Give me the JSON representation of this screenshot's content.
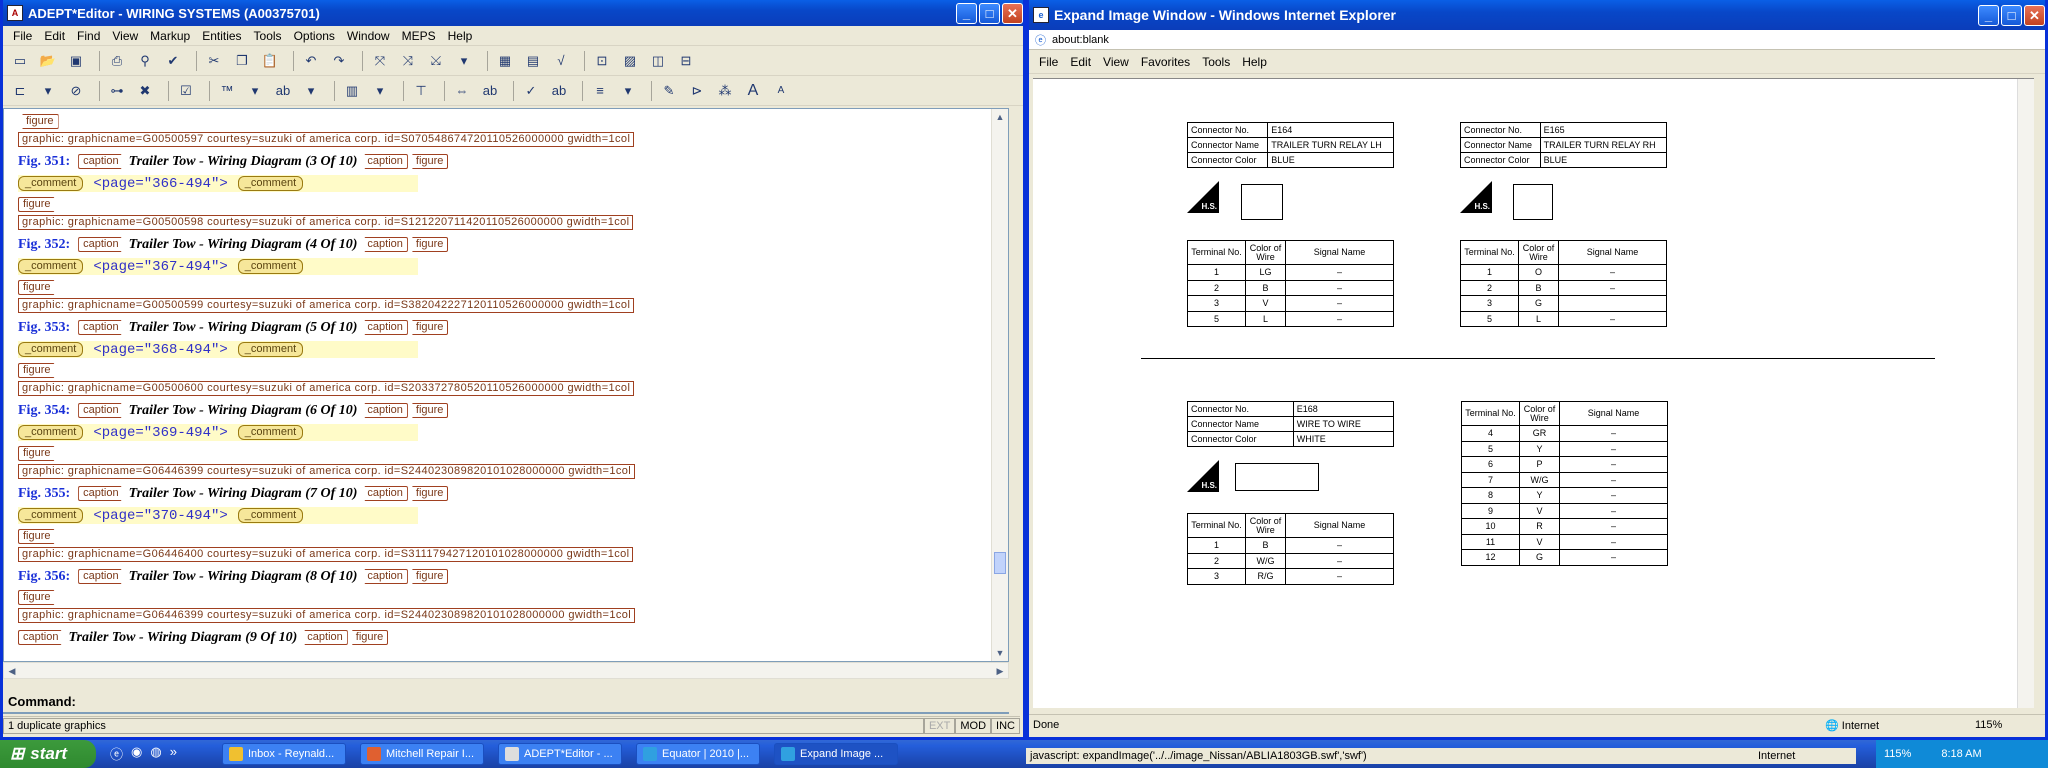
{
  "editor": {
    "title": "ADEPT*Editor - WIRING SYSTEMS (A00375701)",
    "menu": [
      "File",
      "Edit",
      "Find",
      "View",
      "Markup",
      "Entities",
      "Tools",
      "Options",
      "Window",
      "MEPS",
      "Help"
    ],
    "toolbar1_icons": [
      "open-folder-icon",
      "save-icon",
      "print-icon",
      "binoculars-icon",
      "spellcheck-icon",
      "cut-icon",
      "copy-icon",
      "paste-icon",
      "undo-icon",
      "redo-icon",
      "insert-tag-icon",
      "change-tag-icon",
      "split-tag-icon",
      "dropdown-icon",
      "table-icon",
      "matrix-icon",
      "equation-icon",
      "zoom-icon",
      "graphic-icon",
      "columns-icon",
      "rows-icon"
    ],
    "toolbar2_icons": [
      "element-icon",
      "attribute-icon",
      "link-icon",
      "delete-link-icon",
      "check-icon",
      "trademark-icon",
      "spelling-icon",
      "list-icon",
      "tree-icon",
      "expand-icon",
      "abc-icon",
      "align-icon",
      "format-icon",
      "bold-icon",
      "edit-tool-icon",
      "text-larger-icon",
      "text-smaller-icon"
    ],
    "doc": {
      "graphics": [
        "graphic: graphicname=G00500597  courtesy=suzuki  of  america  corp.  id=S070548674720110526000000  gwidth=1col",
        "graphic: graphicname=G00500598  courtesy=suzuki  of  america  corp.  id=S121220711420110526000000  gwidth=1col",
        "graphic: graphicname=G00500599  courtesy=suzuki  of  america  corp.  id=S382042227120110526000000  gwidth=1col",
        "graphic: graphicname=G00500600  courtesy=suzuki  of  america  corp.  id=S203372780520110526000000  gwidth=1col",
        "graphic: graphicname=G06446399  courtesy=suzuki  of  america  corp.  id=S244023089820101028000000  gwidth=1col",
        "graphic: graphicname=G06446400  courtesy=suzuki  of  america  corp.  id=S311179427120101028000000  gwidth=1col",
        "graphic: graphicname=G06446399  courtesy=suzuki  of  america  corp.  id=S244023089820101028000000  gwidth=1col"
      ],
      "figures": [
        {
          "no": "Fig. 351:",
          "caption": "Trailer Tow - Wiring Diagram (3 Of 10)",
          "page": "<page=\"366-494\">"
        },
        {
          "no": "Fig. 352:",
          "caption": "Trailer Tow - Wiring Diagram (4 Of 10)",
          "page": "<page=\"367-494\">"
        },
        {
          "no": "Fig. 353:",
          "caption": "Trailer Tow - Wiring Diagram (5 Of 10)",
          "page": "<page=\"368-494\">"
        },
        {
          "no": "Fig. 354:",
          "caption": "Trailer Tow - Wiring Diagram (6 Of 10)",
          "page": "<page=\"369-494\">"
        },
        {
          "no": "Fig. 355:",
          "caption": "Trailer Tow - Wiring Diagram (7 Of 10)",
          "page": "<page=\"370-494\">"
        },
        {
          "no": "Fig. 356:",
          "caption": "Trailer Tow - Wiring Diagram (8 Of 10)"
        }
      ],
      "last_caption": "Trailer Tow - Wiring Diagram (9 Of 10)",
      "tag_figure": "figure",
      "tag_caption": "caption",
      "tag_comment": "_comment"
    },
    "command_label": "Command:",
    "status_message": "1 duplicate graphics",
    "status_cells": [
      "EXT",
      "MOD",
      "INC"
    ]
  },
  "ie": {
    "title": "Expand Image Window - Windows Internet Explorer",
    "address": "about:blank",
    "menu": [
      "File",
      "Edit",
      "View",
      "Favorites",
      "Tools",
      "Help"
    ],
    "status_text": "Done",
    "zone": "Internet",
    "zoom": "115%",
    "connectors": [
      {
        "no": "E164",
        "name": "TRAILER TURN RELAY LH",
        "color": "BLUE",
        "rows": [
          [
            "1",
            "LG",
            "–"
          ],
          [
            "2",
            "B",
            "–"
          ],
          [
            "3",
            "V",
            "–"
          ],
          [
            "5",
            "L",
            "–"
          ]
        ]
      },
      {
        "no": "E165",
        "name": "TRAILER TURN RELAY RH",
        "color": "BLUE",
        "rows": [
          [
            "1",
            "O",
            "–"
          ],
          [
            "2",
            "B",
            "–"
          ],
          [
            "3",
            "G",
            ""
          ],
          [
            "5",
            "L",
            "–"
          ]
        ]
      },
      {
        "no": "E168",
        "name": "WIRE TO WIRE",
        "color": "WHITE",
        "rows": [
          [
            "1",
            "B",
            "–"
          ],
          [
            "2",
            "W/G",
            "–"
          ],
          [
            "3",
            "R/G",
            "–"
          ]
        ]
      }
    ],
    "extra_rows": [
      [
        "4",
        "GR",
        "–"
      ],
      [
        "5",
        "Y",
        "–"
      ],
      [
        "6",
        "P",
        "–"
      ],
      [
        "7",
        "W/G",
        "–"
      ],
      [
        "8",
        "Y",
        "–"
      ],
      [
        "9",
        "V",
        "–"
      ],
      [
        "10",
        "R",
        "–"
      ],
      [
        "11",
        "V",
        "–"
      ],
      [
        "12",
        "G",
        "–"
      ]
    ],
    "labels": {
      "conn_no": "Connector No.",
      "conn_name": "Connector Name",
      "conn_color": "Connector Color",
      "terminal": "Terminal No.",
      "wire_color": "Color of Wire",
      "signal": "Signal Name",
      "hs": "H.S."
    }
  },
  "taskbar": {
    "start": "start",
    "tasks": [
      "Inbox - Reynald...",
      "Mitchell Repair I...",
      "ADEPT*Editor - ...",
      "Equator | 2010 |...",
      "Expand Image ..."
    ],
    "clock": "8:18 AM",
    "status_overlay": "javascript: expandImage('../../image_Nissan/ABLIA1803GB.swf','swf')",
    "zone": "Internet",
    "zoom": "115%"
  },
  "colors": {
    "xp_blue": "#0a5fe6",
    "fig_blue": "#1a30d8",
    "tag_brown": "#a04020",
    "comment_bg": "#fffbc8"
  }
}
